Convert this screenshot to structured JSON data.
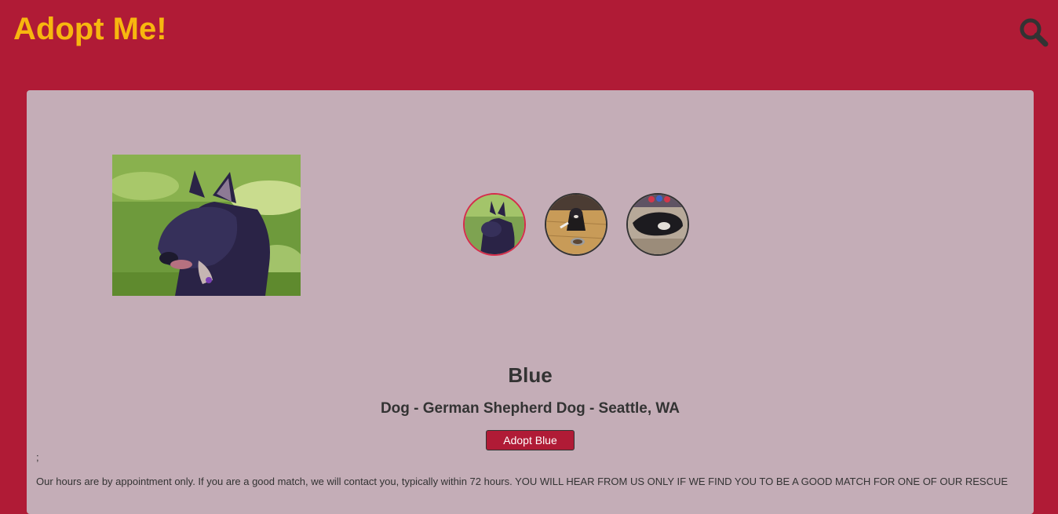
{
  "header": {
    "logo_text": "Adopt Me!",
    "search_icon": "search-icon"
  },
  "colors": {
    "brand_background": "#b01b36",
    "logo": "#f7b70f",
    "card_background": "#c4adb7",
    "text": "#333333",
    "active_thumbnail_border": "#d62c4a"
  },
  "pet": {
    "name": "Blue",
    "meta": "Dog - German Shepherd Dog - Seattle, WA",
    "adopt_button_label": "Adopt Blue",
    "stray_text": ";",
    "description": "Our hours are by appointment only. If you are a good match, we will contact you, typically within 72 hours. YOU WILL HEAR FROM US ONLY IF WE FIND YOU TO BE A GOOD MATCH FOR ONE OF OUR RESCUE",
    "thumbnails": [
      {
        "label": "photo-1",
        "active": true
      },
      {
        "label": "photo-2",
        "active": false
      },
      {
        "label": "photo-3",
        "active": false
      }
    ]
  }
}
